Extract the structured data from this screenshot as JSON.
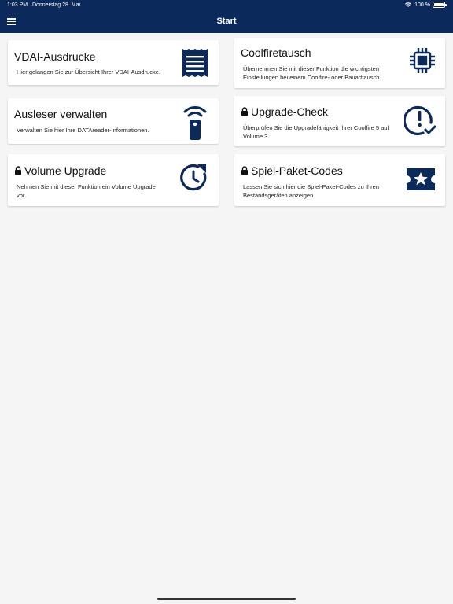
{
  "status": {
    "time": "1:03 PM",
    "date": "Donnerstag 28. Mai",
    "battery": "100 %"
  },
  "header": {
    "title": "Start"
  },
  "cards": [
    {
      "title": "VDAI-Ausdrucke",
      "description": "Hier gelangen Sie zur Übersicht Ihrer VDAI-Ausdrucke.",
      "locked": false,
      "icon": "receipt-icon"
    },
    {
      "title": "Coolfiretausch",
      "description": "Übernehmen Sie mit dieser Funktion die wichtigsten Einstellungen bei einem Coolfire- oder Bauarttausch.",
      "locked": false,
      "icon": "chip-icon"
    },
    {
      "title": "Ausleser verwalten",
      "description": "Verwalten Sie hier Ihre DATAreader-Informationen.",
      "locked": false,
      "icon": "reader-icon"
    },
    {
      "title": "Upgrade-Check",
      "description": "Überprüfen Sie die Upgradefähigkeit Ihrer Coolfire 5 auf Volume 3.",
      "locked": true,
      "icon": "alert-check-icon"
    },
    {
      "title": "Volume Upgrade",
      "description": "Nehmen Sie mit dieser Funktion ein Volume Upgrade vor.",
      "locked": true,
      "icon": "clock-upgrade-icon"
    },
    {
      "title": "Spiel-Paket-Codes",
      "description": "Lassen Sie sich hier die Spiel-Paket-Codes zu Ihren Bestandsgeräten anzeigen.",
      "locked": true,
      "icon": "ticket-star-icon"
    }
  ],
  "colors": {
    "primary": "#0b2a5b",
    "background": "#f5f5f5",
    "card": "#ffffff"
  }
}
